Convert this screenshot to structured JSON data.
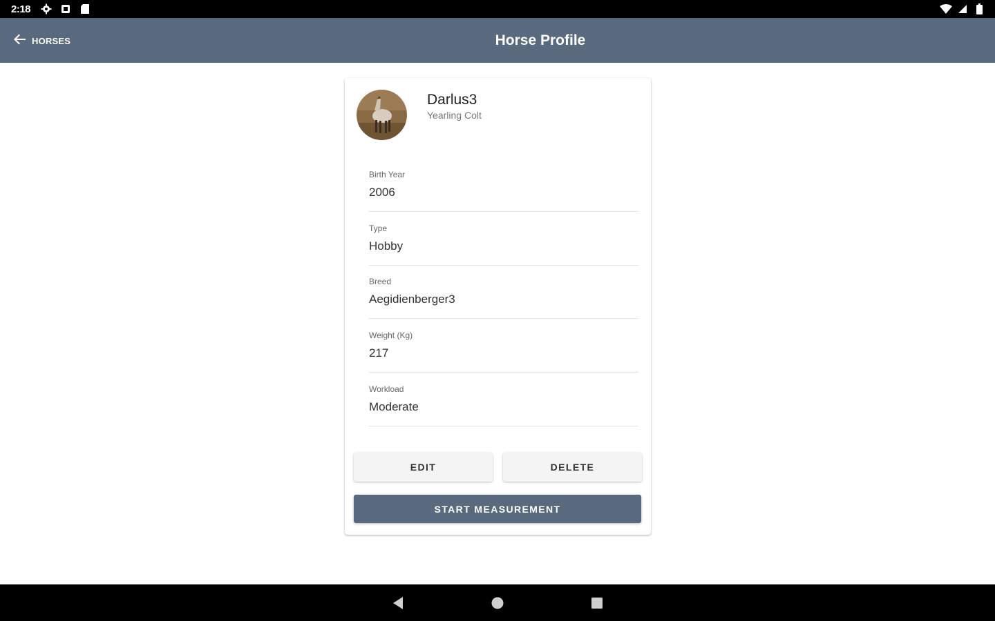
{
  "status_bar": {
    "time": "2:18",
    "left_icons": [
      "gear-icon",
      "notification-icon",
      "sd-card-icon"
    ],
    "right_icons": [
      "wifi-icon",
      "signal-icon",
      "battery-icon"
    ]
  },
  "app_bar": {
    "back_label": "HORSES",
    "title": "Horse Profile",
    "color": "#5a6a7e"
  },
  "profile": {
    "name": "Darlus3",
    "subtitle": "Yearling Colt",
    "avatar": "horse-photo"
  },
  "fields": [
    {
      "label": "Birth Year",
      "value": "2006"
    },
    {
      "label": "Type",
      "value": "Hobby"
    },
    {
      "label": "Breed",
      "value": "Aegidienberger3"
    },
    {
      "label": "Weight (Kg)",
      "value": "217"
    },
    {
      "label": "Workload",
      "value": "Moderate"
    }
  ],
  "actions": {
    "edit_label": "EDIT",
    "delete_label": "DELETE",
    "start_label": "START MEASUREMENT"
  },
  "nav_bar": {
    "icons": [
      "back-triangle-icon",
      "home-circle-icon",
      "recents-square-icon"
    ]
  }
}
